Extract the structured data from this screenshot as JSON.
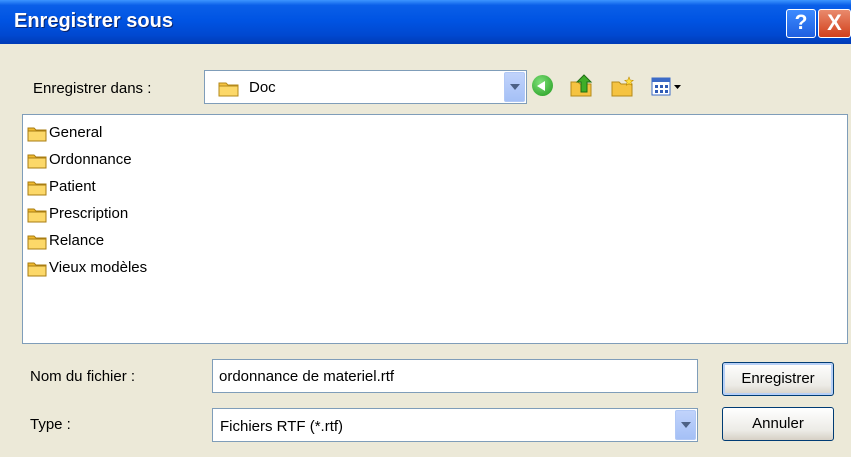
{
  "window": {
    "title": "Enregistrer sous",
    "help_label": "?",
    "close_label": "X"
  },
  "save_in": {
    "label": "Enregistrer dans :",
    "current_folder": "Doc",
    "toolbar_icons": [
      "back-icon",
      "up-folder-icon",
      "new-folder-icon",
      "views-menu-icon"
    ]
  },
  "files": [
    {
      "name": "General"
    },
    {
      "name": "Ordonnance"
    },
    {
      "name": "Patient"
    },
    {
      "name": "Prescription"
    },
    {
      "name": "Relance"
    },
    {
      "name": "Vieux modèles"
    }
  ],
  "filename": {
    "label": "Nom du fichier :",
    "value": "ordonnance de materiel.rtf"
  },
  "type": {
    "label": "Type :",
    "selected": "Fichiers RTF (*.rtf)"
  },
  "buttons": {
    "save": "Enregistrer",
    "cancel": "Annuler"
  },
  "colors": {
    "titlebar": "#0054e3",
    "dialog_bg": "#ece9d8",
    "field_border": "#7f9db9",
    "folder": "#f5c341"
  }
}
